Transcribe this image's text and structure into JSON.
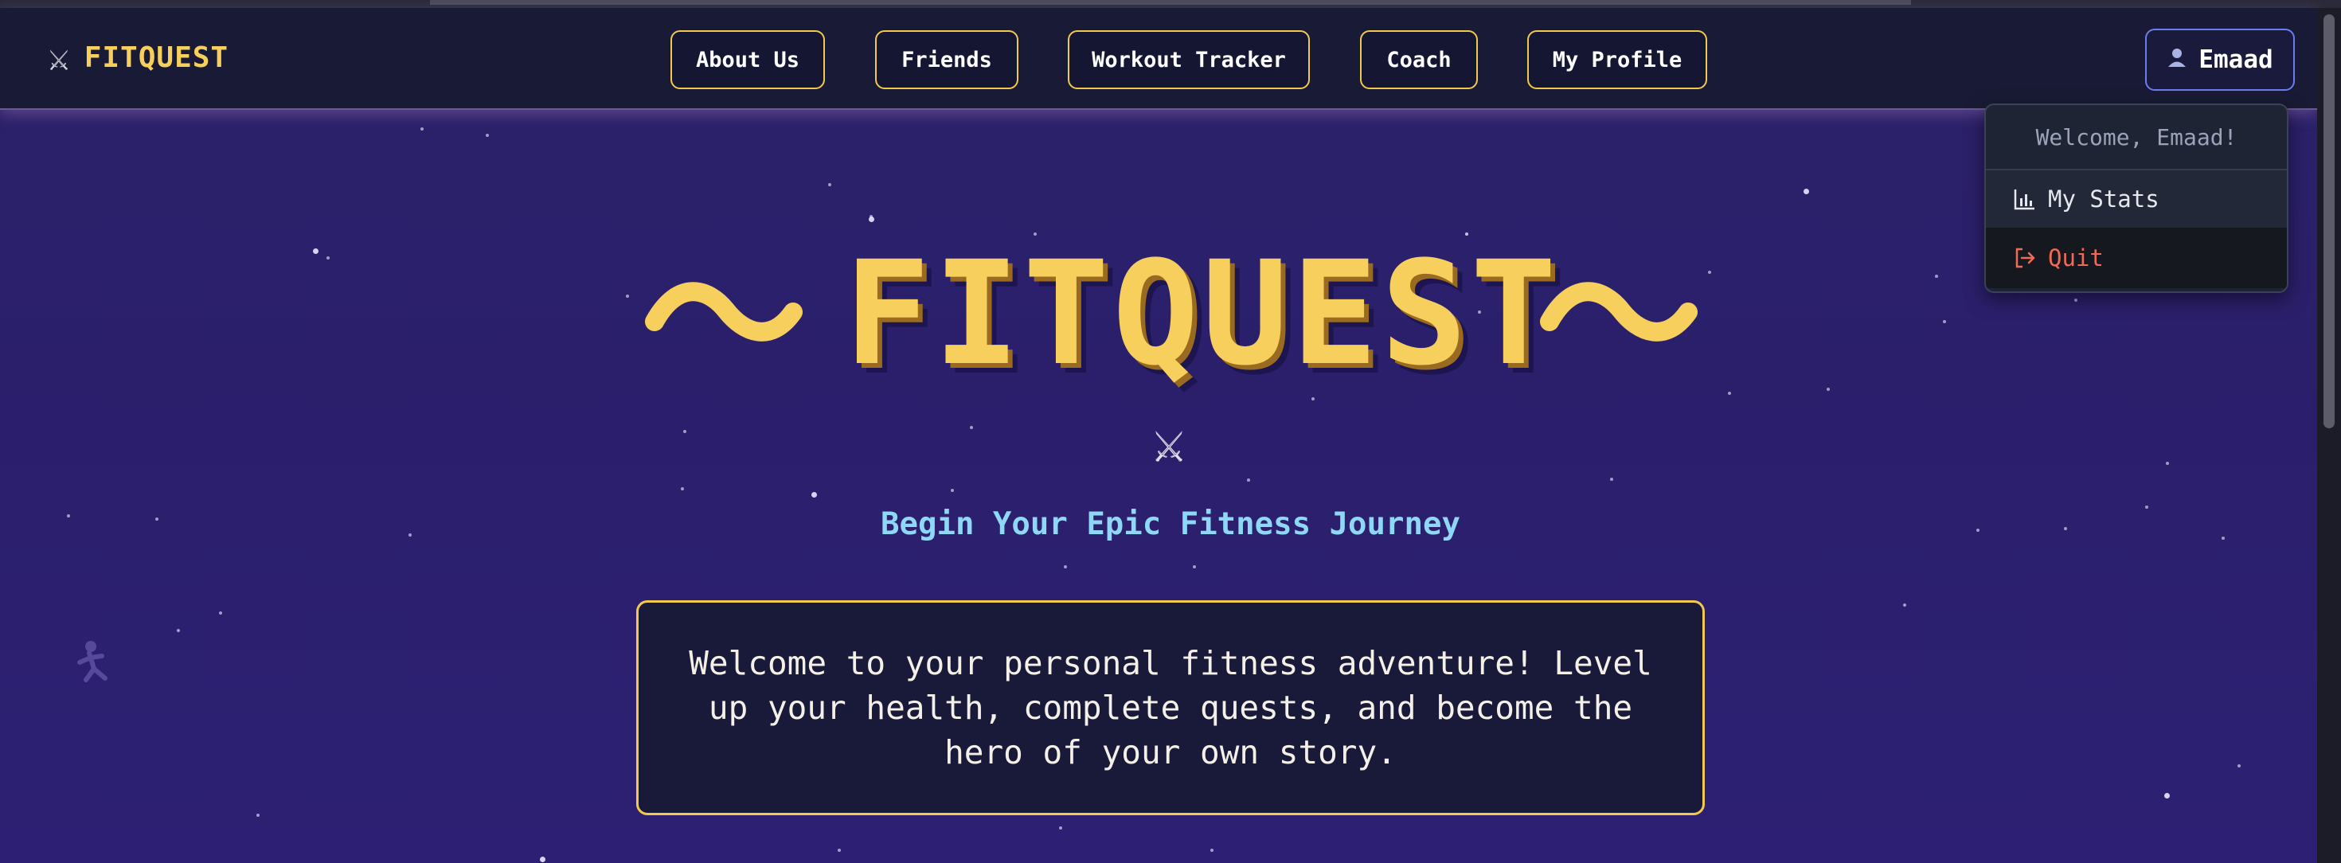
{
  "brand": {
    "icon": "crossed-swords-icon",
    "name": "FITQUEST"
  },
  "nav": {
    "items": [
      {
        "label": "About Us"
      },
      {
        "label": "Friends"
      },
      {
        "label": "Workout Tracker"
      },
      {
        "label": "Coach"
      },
      {
        "label": "My Profile"
      }
    ]
  },
  "user": {
    "icon": "person-icon",
    "name": "Emaad"
  },
  "dropdown": {
    "welcome": "Welcome, Emaad!",
    "items": [
      {
        "label": "My Stats",
        "icon": "bar-chart-icon"
      },
      {
        "label": "Quit",
        "icon": "logout-icon"
      }
    ]
  },
  "hero": {
    "title": "FITQUEST",
    "emblem": "crossed-swords-icon",
    "subtitle": "Begin Your Epic Fitness Journey",
    "welcome": "Welcome to your personal fitness adventure! Level up your health, complete quests, and become the hero of your own story."
  },
  "colors": {
    "accent_gold": "#f6cf5c",
    "nav_background": "#191a35",
    "page_background": "#2b2068",
    "subtitle_blue": "#8ed8f5",
    "quit_red": "#ef6b57",
    "user_border": "#6d7cf0"
  }
}
